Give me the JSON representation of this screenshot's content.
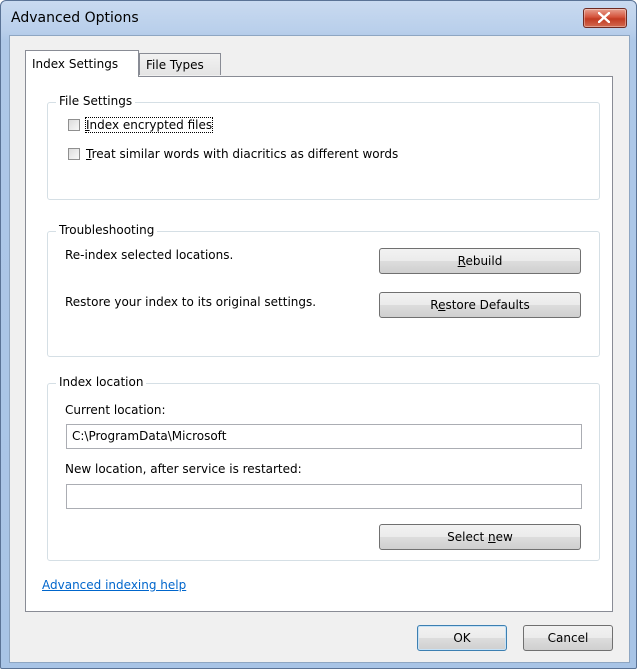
{
  "window": {
    "title": "Advanced Options"
  },
  "tabs": [
    {
      "label": "Index Settings"
    },
    {
      "label": "File Types"
    }
  ],
  "file_settings": {
    "title": "File Settings",
    "encrypted": {
      "mnemonic": "I",
      "rest": "ndex encrypted files",
      "checked": false
    },
    "diacritics": {
      "mnemonic": "T",
      "rest": "reat similar words with diacritics as different words",
      "checked": false
    }
  },
  "troubleshooting": {
    "title": "Troubleshooting",
    "reindex_text": "Re-index selected locations.",
    "rebuild": {
      "mnemonic": "R",
      "rest": "ebuild"
    },
    "restore_text": "Restore your index to its original settings.",
    "restore": {
      "pre": "R",
      "mnemonic": "e",
      "rest": "store Defaults"
    }
  },
  "index_location": {
    "title": "Index location",
    "current_label": "Current location:",
    "current_value": "C:\\ProgramData\\Microsoft",
    "new_label": "New location, after service is restarted:",
    "new_value": "",
    "select_new": {
      "pre": "Select ",
      "mnemonic": "n",
      "rest": "ew"
    }
  },
  "help_link": "Advanced indexing help",
  "footer": {
    "ok": "OK",
    "cancel": "Cancel"
  }
}
